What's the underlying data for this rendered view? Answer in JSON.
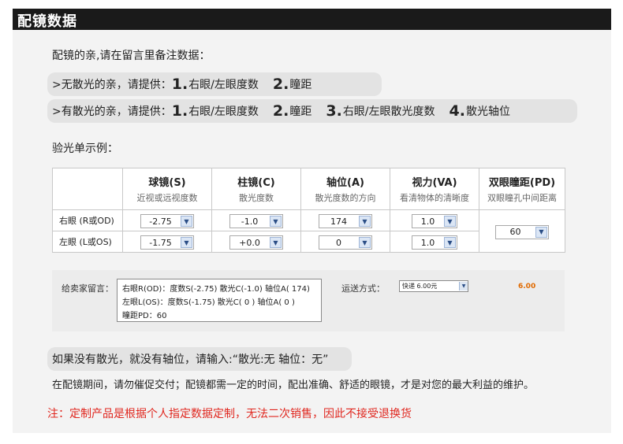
{
  "header": {
    "title": "配镜数据"
  },
  "intro": "配镜的亲,请在留言里备注数据：",
  "no_astig": {
    "prefix": ">无散光的亲，请提供：",
    "items": [
      {
        "n": "1.",
        "text": "右眼/左眼度数"
      },
      {
        "n": "2.",
        "text": "瞳距"
      }
    ]
  },
  "astig": {
    "prefix": ">有散光的亲，请提供：",
    "items": [
      {
        "n": "1.",
        "text": "右眼/左眼度数"
      },
      {
        "n": "2.",
        "text": "瞳距"
      },
      {
        "n": "3.",
        "text": "右眼/左眼散光度数"
      },
      {
        "n": "4.",
        "text": "散光轴位"
      }
    ]
  },
  "sample_label": "验光单示例：",
  "table": {
    "columns": [
      {
        "title": "球镜(S)",
        "sub": "近视或远视度数"
      },
      {
        "title": "柱镜(C)",
        "sub": "散光度数"
      },
      {
        "title": "轴位(A)",
        "sub": "散光度数的方向"
      },
      {
        "title": "视力(VA)",
        "sub": "看清物体的清晰度"
      },
      {
        "title": "双眼瞳距(PD)",
        "sub": "双眼瞳孔中间距离"
      }
    ],
    "rows": [
      {
        "label": "右眼 (R或OD)",
        "sphere": "-2.75",
        "cyl": "-1.0",
        "axis": "174",
        "va": "1.0"
      },
      {
        "label": "左眼 (L或OS)",
        "sphere": "-1.75",
        "cyl": "+0.0",
        "axis": "0",
        "va": "1.0"
      }
    ],
    "pd": "60"
  },
  "form": {
    "message_label": "给卖家留言：",
    "message_lines": [
      "右眼R(OD)：度数S(-2.75)  散光C(-1.0)  轴位A( 174)",
      "左眼L(OS)：度数S(-1.75)  散光C( 0 )    轴位A( 0 )",
      "瞳距PD：60"
    ],
    "shipping_label": "运送方式：",
    "shipping_value": "快递 6.00元",
    "price": "6.00"
  },
  "notes": {
    "no_astig_tip": "如果没有散光，就没有轴位，请输入:“散光:无   轴位：无”",
    "reminder": "在配镜期间，请勿催促交付；配镜都需一定的时间，配出准确、舒适的眼镜，才是对您的最大利益的维护。",
    "warning": "注：定制产品是根据个人指定数据定制，无法二次销售，因此不接受退换货"
  },
  "colors": {
    "title_bg": "#1a1a1a",
    "panel_bg": "#f3f3f3",
    "pill_bg": "#e3e3e3",
    "warning": "#e0271f",
    "price": "#e06a00"
  },
  "icons": {
    "select_arrow": "chevron-down-icon"
  }
}
